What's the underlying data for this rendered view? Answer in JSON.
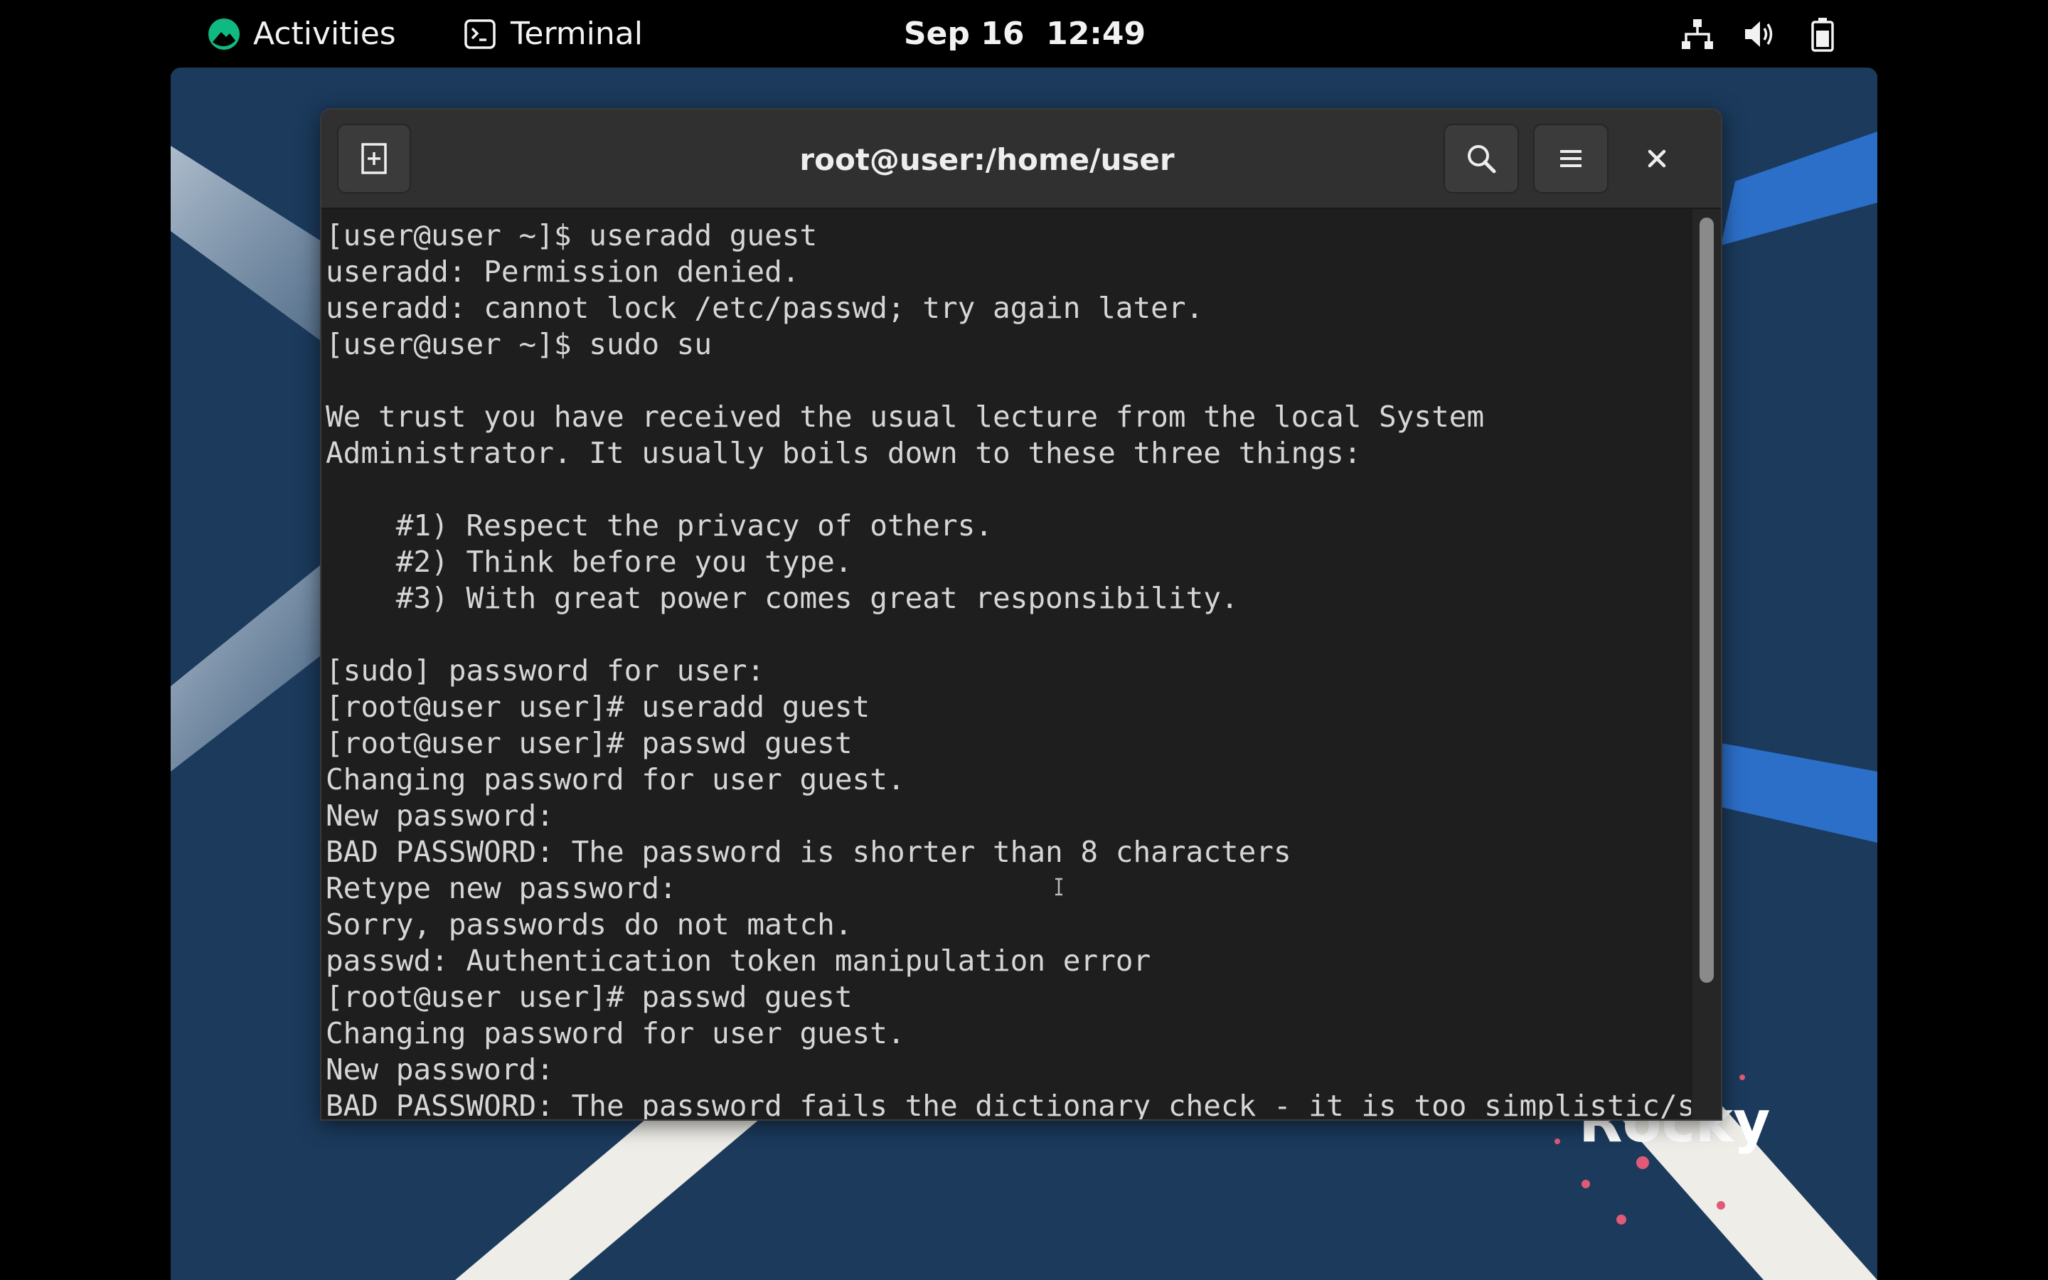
{
  "topbar": {
    "activities_label": "Activities",
    "app_name": "Terminal",
    "clock": "Sep 16  12:49",
    "icons": [
      "network-icon",
      "volume-icon",
      "battery-icon"
    ]
  },
  "wallpaper": {
    "brand_text": "Rocky",
    "background_color": "#1b3a5c"
  },
  "window": {
    "title": "root@user:/home/user"
  },
  "terminal": {
    "lines": [
      "[user@user ~]$ useradd guest",
      "useradd: Permission denied.",
      "useradd: cannot lock /etc/passwd; try again later.",
      "[user@user ~]$ sudo su",
      "",
      "We trust you have received the usual lecture from the local System",
      "Administrator. It usually boils down to these three things:",
      "",
      "    #1) Respect the privacy of others.",
      "    #2) Think before you type.",
      "    #3) With great power comes great responsibility.",
      "",
      "[sudo] password for user:",
      "[root@user user]# useradd guest",
      "[root@user user]# passwd guest",
      "Changing password for user guest.",
      "New password:",
      "BAD PASSWORD: The password is shorter than 8 characters",
      "Retype new password:",
      "Sorry, passwords do not match.",
      "passwd: Authentication token manipulation error",
      "[root@user user]# passwd guest",
      "Changing password for user guest.",
      "New password:",
      "BAD PASSWORD: The password fails the dictionary check - it is too simplistic/sys"
    ],
    "text_color": "#d6d6d6",
    "background_color": "#1e1e1e"
  }
}
